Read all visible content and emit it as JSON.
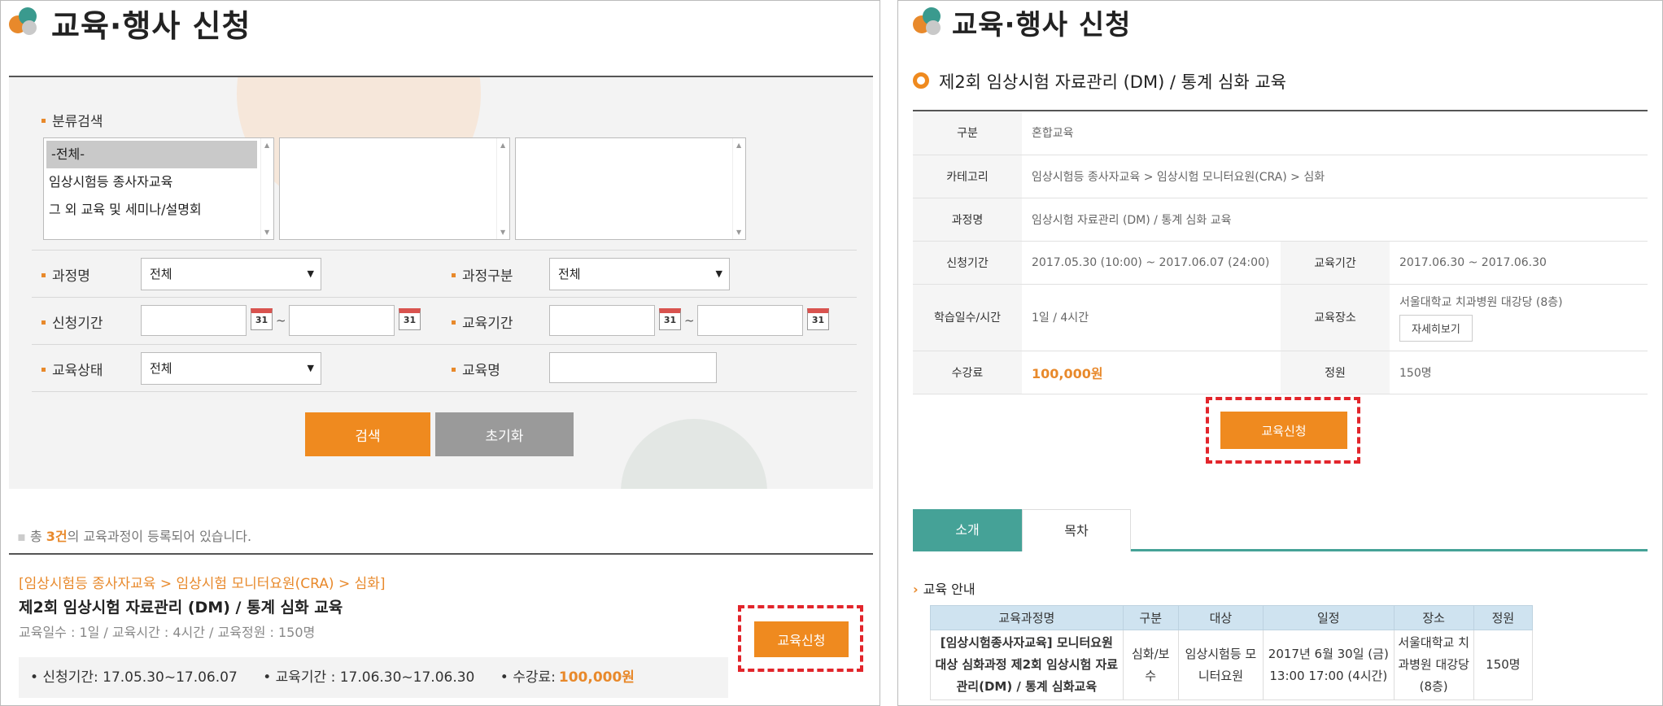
{
  "left": {
    "page_title": "교육·행사 신청",
    "category_label": "분류검색",
    "category_list": [
      "-전체-",
      "임상시험등 종사자교육",
      "그 외 교육 및 세미나/설명회"
    ],
    "course_name_label": "과정명",
    "course_name_value": "전체",
    "course_type_label": "과정구분",
    "course_type_value": "전체",
    "apply_period_label": "신청기간",
    "edu_period_label": "교육기간",
    "edu_status_label": "교육상태",
    "edu_status_value": "전체",
    "edu_name_label": "교육명",
    "calendar_icon_text": "31",
    "tilde": "~",
    "search_button": "검색",
    "reset_button": "초기화",
    "total_prefix": "총 ",
    "total_count": "3건",
    "total_suffix": "의 교육과정이 등록되어 있습니다.",
    "course": {
      "category_path": "[임상시험등 종사자교육 > 임상시험 모니터요원(CRA) > 심화]",
      "title": "제2회 임상시험 자료관리 (DM) / 통계 심화 교육",
      "meta": "교육일수 : 1일  /  교육시간 : 4시간  /  교육정원 : 150명",
      "apply_period": "• 신청기간: 17.05.30~17.06.07",
      "edu_period": "• 교육기간 : 17.06.30~17.06.30",
      "fee_label": "• 수강료:",
      "fee_value": "100,000원",
      "apply_button": "교육신청"
    }
  },
  "right": {
    "page_title": "교육·행사 신청",
    "course_title": "제2회 임상시험 자료관리 (DM) / 통계 심화 교육",
    "rows": {
      "type_label": "구분",
      "type_value": "혼합교육",
      "category_label": "카테고리",
      "category_value": "임상시험등 종사자교육 > 임상시험 모니터요원(CRA) > 심화",
      "course_label": "과정명",
      "course_value": "임상시험 자료관리 (DM) / 통계 심화 교육",
      "apply_label": "신청기간",
      "apply_value": "2017.05.30 (10:00) ~ 2017.06.07 (24:00)",
      "edu_period_label": "교육기간",
      "edu_period_value": "2017.06.30 ~ 2017.06.30",
      "days_label": "학습일수/시간",
      "days_value": "1일 / 4시간",
      "place_label": "교육장소",
      "place_value": "서울대학교 치과병원 대강당 (8층)",
      "detail_button": "자세히보기",
      "fee_label": "수강료",
      "fee_value": "100,000원",
      "capacity_label": "정원",
      "capacity_value": "150명"
    },
    "apply_button": "교육신청",
    "tabs": [
      "소개",
      "목차"
    ],
    "section_title": "교육 안내",
    "edu_table": {
      "headers": [
        "교육과정명",
        "구분",
        "대상",
        "일정",
        "장소",
        "정원"
      ],
      "row": {
        "name": "[임상시험종사자교육] 모니터요원 대상 심화과정 제2회 임상시험 자료관리(DM) / 통계 심화교육",
        "type": "심화/보수",
        "target": "임상시험등 모니터요원",
        "schedule": "2017년 6월 30일 (금) 13:00 17:00 (4시간)",
        "place": "서울대학교 치과병원 대강당 (8층)",
        "capacity": "150명"
      }
    }
  }
}
